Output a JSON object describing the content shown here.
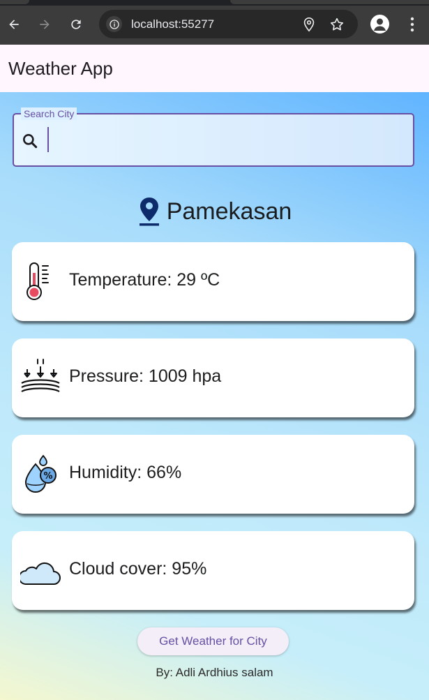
{
  "browser": {
    "url": "localhost:55277"
  },
  "app": {
    "title": "Weather App"
  },
  "search": {
    "label": "Search City",
    "value": ""
  },
  "location": {
    "city": "Pamekasan"
  },
  "cards": {
    "temperature": "Temperature: 29 ºC",
    "pressure": "Pressure: 1009 hpa",
    "humidity": "Humidity: 66%",
    "cloud": "Cloud cover: 95%"
  },
  "actions": {
    "get_weather": "Get Weather for City"
  },
  "footer": {
    "byline": "By: Adli Ardhius salam"
  },
  "colors": {
    "accent": "#6750a4",
    "pin": "#0d2a6b"
  }
}
